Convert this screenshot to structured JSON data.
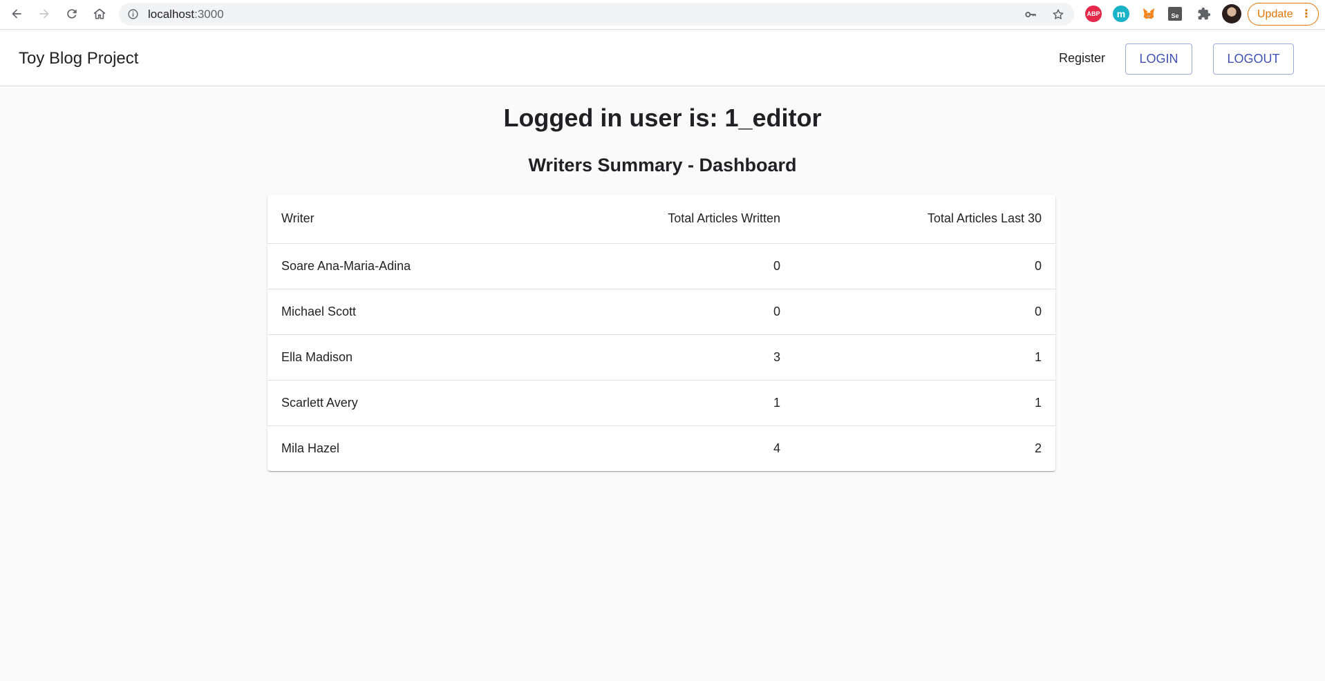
{
  "browser": {
    "url_host": "localhost",
    "url_port": ":3000",
    "update_label": "Update",
    "extensions": [
      "adblock-icon",
      "m-extension-icon",
      "metamask-icon",
      "selenium-icon",
      "puzzle-icon",
      "profile-avatar"
    ],
    "ext_abp_label": "ABP",
    "ext_m_label": "m",
    "ext_se_label": "Se"
  },
  "appbar": {
    "brand": "Toy Blog Project",
    "register_label": "Register",
    "login_label": "LOGIN",
    "logout_label": "LOGOUT"
  },
  "main": {
    "headline": "Logged in user is: 1_editor",
    "subheading": "Writers Summary - Dashboard"
  },
  "table": {
    "headers": [
      "Writer",
      "Total Articles Written",
      "Total Articles Last 30"
    ],
    "rows": [
      [
        "Soare Ana-Maria-Adina",
        "0",
        "0"
      ],
      [
        "Michael Scott",
        "0",
        "0"
      ],
      [
        "Ella Madison",
        "3",
        "1"
      ],
      [
        "Scarlett Avery",
        "1",
        "1"
      ],
      [
        "Mila Hazel",
        "4",
        "2"
      ]
    ]
  },
  "colors": {
    "primary": "#3f51b5",
    "update_orange": "#e37400",
    "background": "#fafafa"
  }
}
